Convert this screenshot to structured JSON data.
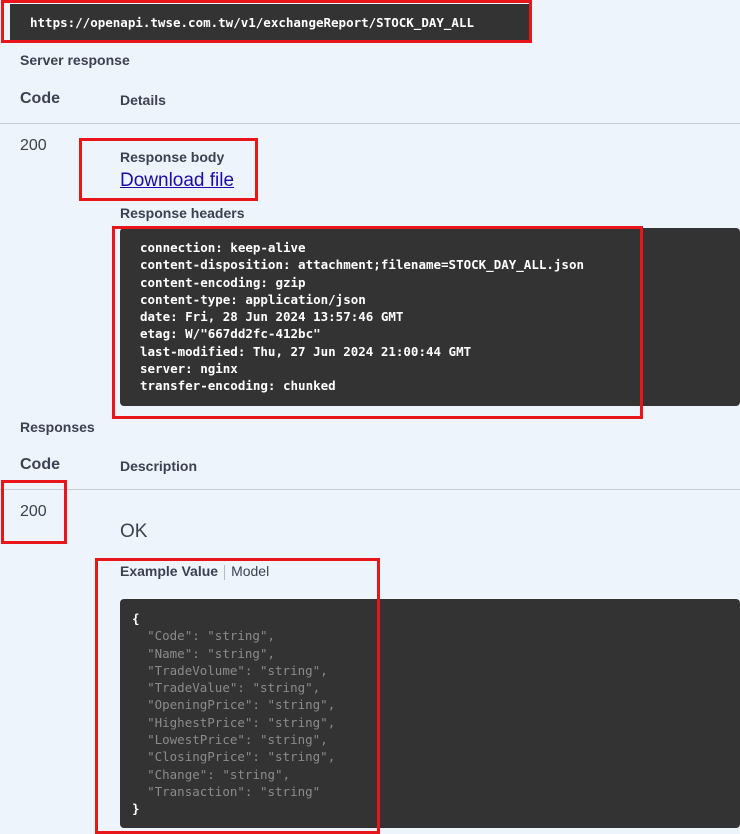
{
  "request_url": "https://openapi.twse.com.tw/v1/exchangeReport/STOCK_DAY_ALL",
  "server_response": {
    "section_title": "Server response",
    "col_code": "Code",
    "col_details": "Details",
    "status_code": "200",
    "response_body_label": "Response body",
    "download_link": "Download file",
    "response_headers_label": "Response headers",
    "headers": [
      "connection: keep-alive",
      "content-disposition: attachment;filename=STOCK_DAY_ALL.json",
      "content-encoding: gzip",
      "content-type: application/json",
      "date: Fri, 28 Jun 2024 13:57:46 GMT",
      "etag: W/\"667dd2fc-412bc\"",
      "last-modified: Thu, 27 Jun 2024 21:00:44 GMT",
      "server: nginx",
      "transfer-encoding: chunked"
    ]
  },
  "responses": {
    "section_title": "Responses",
    "col_code": "Code",
    "col_description": "Description",
    "status_code": "200",
    "description": "OK",
    "tab_example": "Example Value",
    "tab_model": "Model",
    "json_open": "{",
    "json_close": "}",
    "json_fields": [
      {
        "key": "\"Code\"",
        "value": "\"string\""
      },
      {
        "key": "\"Name\"",
        "value": "\"string\""
      },
      {
        "key": "\"TradeVolume\"",
        "value": "\"string\""
      },
      {
        "key": "\"TradeValue\"",
        "value": "\"string\""
      },
      {
        "key": "\"OpeningPrice\"",
        "value": "\"string\""
      },
      {
        "key": "\"HighestPrice\"",
        "value": "\"string\""
      },
      {
        "key": "\"LowestPrice\"",
        "value": "\"string\""
      },
      {
        "key": "\"ClosingPrice\"",
        "value": "\"string\""
      },
      {
        "key": "\"Change\"",
        "value": "\"string\""
      },
      {
        "key": "\"Transaction\"",
        "value": "\"string\""
      }
    ]
  },
  "colors": {
    "highlight": "#e8151b",
    "dark_panel": "#333333",
    "panel_bg": "#eef4fb",
    "link": "#1a0dab"
  }
}
